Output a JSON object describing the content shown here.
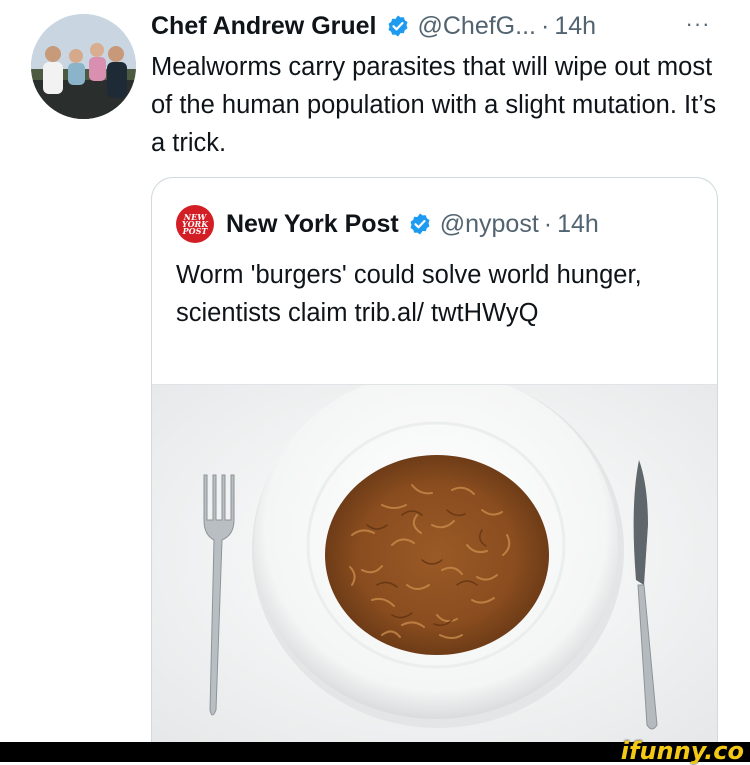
{
  "tweet": {
    "author_name": "Chef Andrew Gruel",
    "handle": "@ChefG...",
    "separator": "·",
    "time": "14h",
    "more_label": "···",
    "text": "Mealworms carry parasites that will wipe out most of the human population with a slight mutation. It’s a trick."
  },
  "quote": {
    "logo_text_line1": "NEW",
    "logo_text_line2": "YORK",
    "logo_text_line3": "POST",
    "author_name": "New York Post",
    "handle": "@nypost",
    "separator": "·",
    "time": "14h",
    "text": "Worm 'burgers' could solve world hunger, scientists claim trib.al/ twtHWyQ"
  },
  "watermark": "ifunny.co",
  "colors": {
    "verified": "#1d9bf0",
    "secondary_text": "#536471",
    "nyp_red": "#d31e25",
    "watermark": "#f4c915"
  },
  "icons": {
    "verified": "verified-badge-icon",
    "more": "more-options-icon"
  }
}
